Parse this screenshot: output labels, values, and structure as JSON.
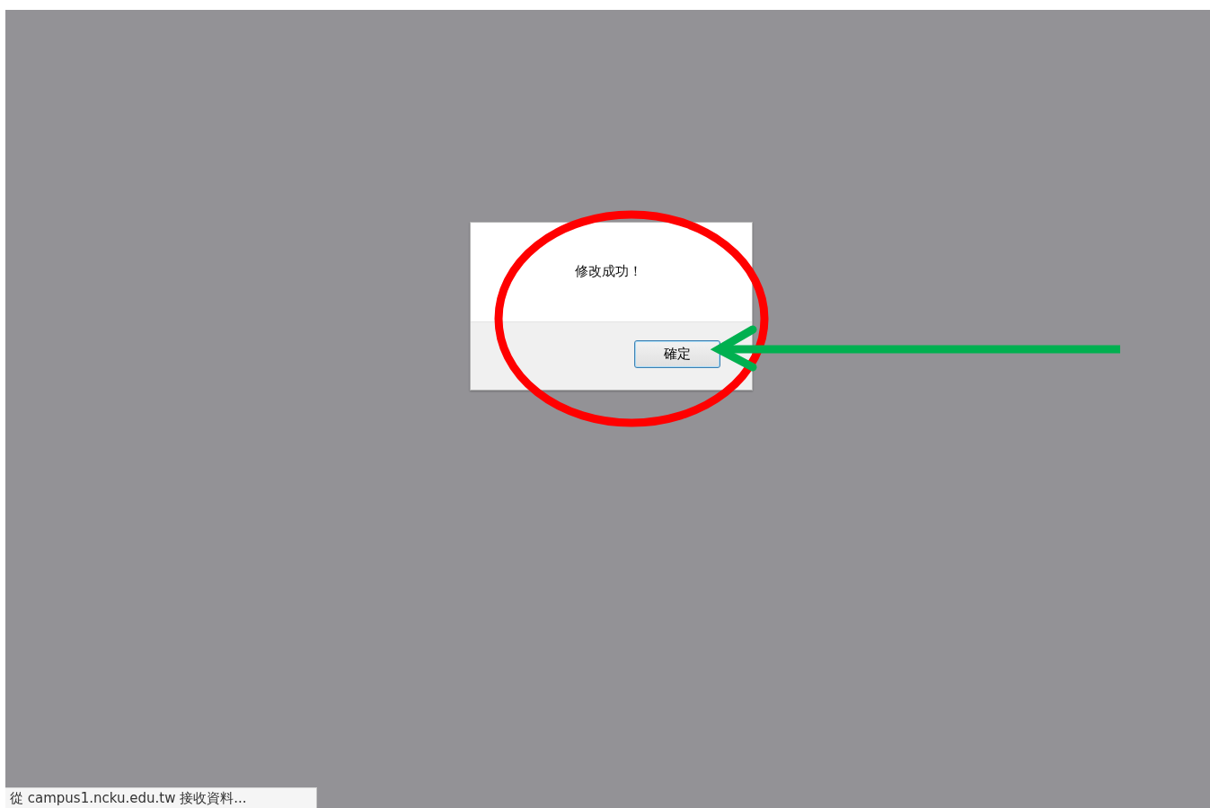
{
  "dialog": {
    "message": "修改成功！",
    "buttons": [
      "確定"
    ]
  },
  "status_bar": {
    "text": "從 campus1.ncku.edu.tw 接收資料..."
  }
}
